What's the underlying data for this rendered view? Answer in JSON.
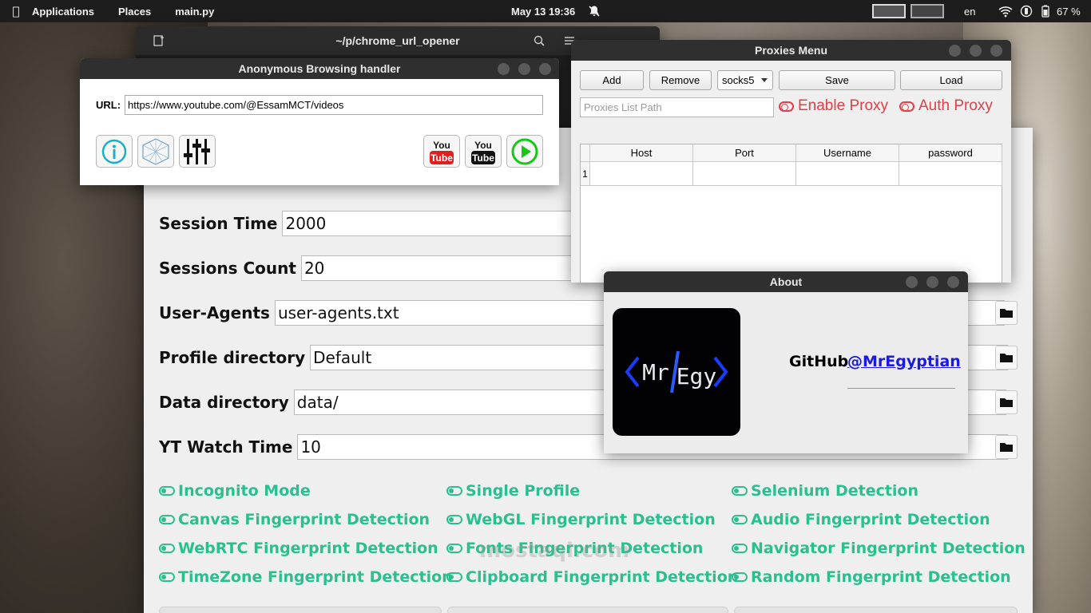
{
  "topbar": {
    "applications": "Applications",
    "places": "Places",
    "active_app": "main.py",
    "clock": "May 13  19:36",
    "language": "en",
    "battery": "67 %"
  },
  "terminal": {
    "title": "~/p/chrome_url_opener"
  },
  "anon": {
    "title": "Anonymous Browsing handler",
    "url_label": "URL:",
    "url_value": "https://www.youtube.com/@EssamMCT/videos",
    "buttons": [
      "info-icon",
      "network-icon",
      "sliders-icon",
      "youtube-red-icon",
      "youtube-black-icon",
      "play-icon"
    ]
  },
  "main": {
    "fields": [
      {
        "label": "Session Time",
        "value": "2000"
      },
      {
        "label": "Sessions Count",
        "value": "20"
      },
      {
        "label": "User-Agents",
        "value": "user-agents.txt"
      },
      {
        "label": "Profile directory",
        "value": "Default"
      },
      {
        "label": "Data directory",
        "value": "data/"
      },
      {
        "label": "YT Watch Time",
        "value": "10"
      }
    ],
    "toggles": [
      "Incognito Mode",
      "Single Profile",
      "Selenium Detection",
      "Canvas Fingerprint Detection",
      "WebGL Fingerprint Detection",
      "Audio Fingerprint Detection",
      "WebRTC Fingerprint Detection",
      "Fonts Fingerprint Detection",
      "Navigator Fingerprint Detection",
      "TimeZone Fingerprint Detection",
      "Clipboard Fingerprint Detection",
      "Random Fingerprint Detection"
    ],
    "accent": "#2bbf8f"
  },
  "proxies": {
    "title": "Proxies Menu",
    "add": "Add",
    "remove": "Remove",
    "protocol": "socks5",
    "save": "Save",
    "load": "Load",
    "path_placeholder": "Proxies List Path",
    "enable_proxy": "Enable Proxy",
    "auth_proxy": "Auth Proxy",
    "columns": [
      "Host",
      "Port",
      "Username",
      "password"
    ],
    "row_number": "1",
    "accent": "#e0404a"
  },
  "about": {
    "title": "About",
    "logo_text": "<Mr/Egy>",
    "github_label": "GitHub",
    "github_link": "@MrEgyptian"
  },
  "watermark": "mostaql.com"
}
